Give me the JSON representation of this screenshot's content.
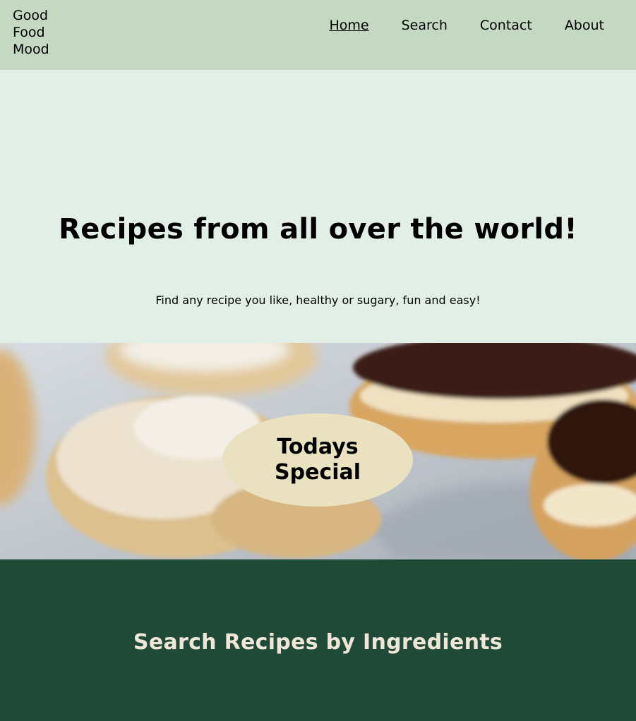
{
  "header": {
    "logo_lines": [
      "Good",
      "Food",
      "Mood"
    ],
    "nav": [
      {
        "label": "Home",
        "active": true
      },
      {
        "label": "Search",
        "active": false
      },
      {
        "label": "Contact",
        "active": false
      },
      {
        "label": "About",
        "active": false
      }
    ]
  },
  "hero": {
    "title": "Recipes from all over the world!",
    "subtitle": "Find any recipe you like, healthy or sugary, fun and easy!"
  },
  "special": {
    "label": "Todays Special"
  },
  "search_section": {
    "title": "Search Recipes by Ingredients"
  },
  "colors": {
    "header_bg": "#c4d8c2",
    "hero_bg": "#e1efe7",
    "special_oval": "#e9e1c0",
    "search_bg": "#1f4a37",
    "search_title": "#efe6d8"
  }
}
